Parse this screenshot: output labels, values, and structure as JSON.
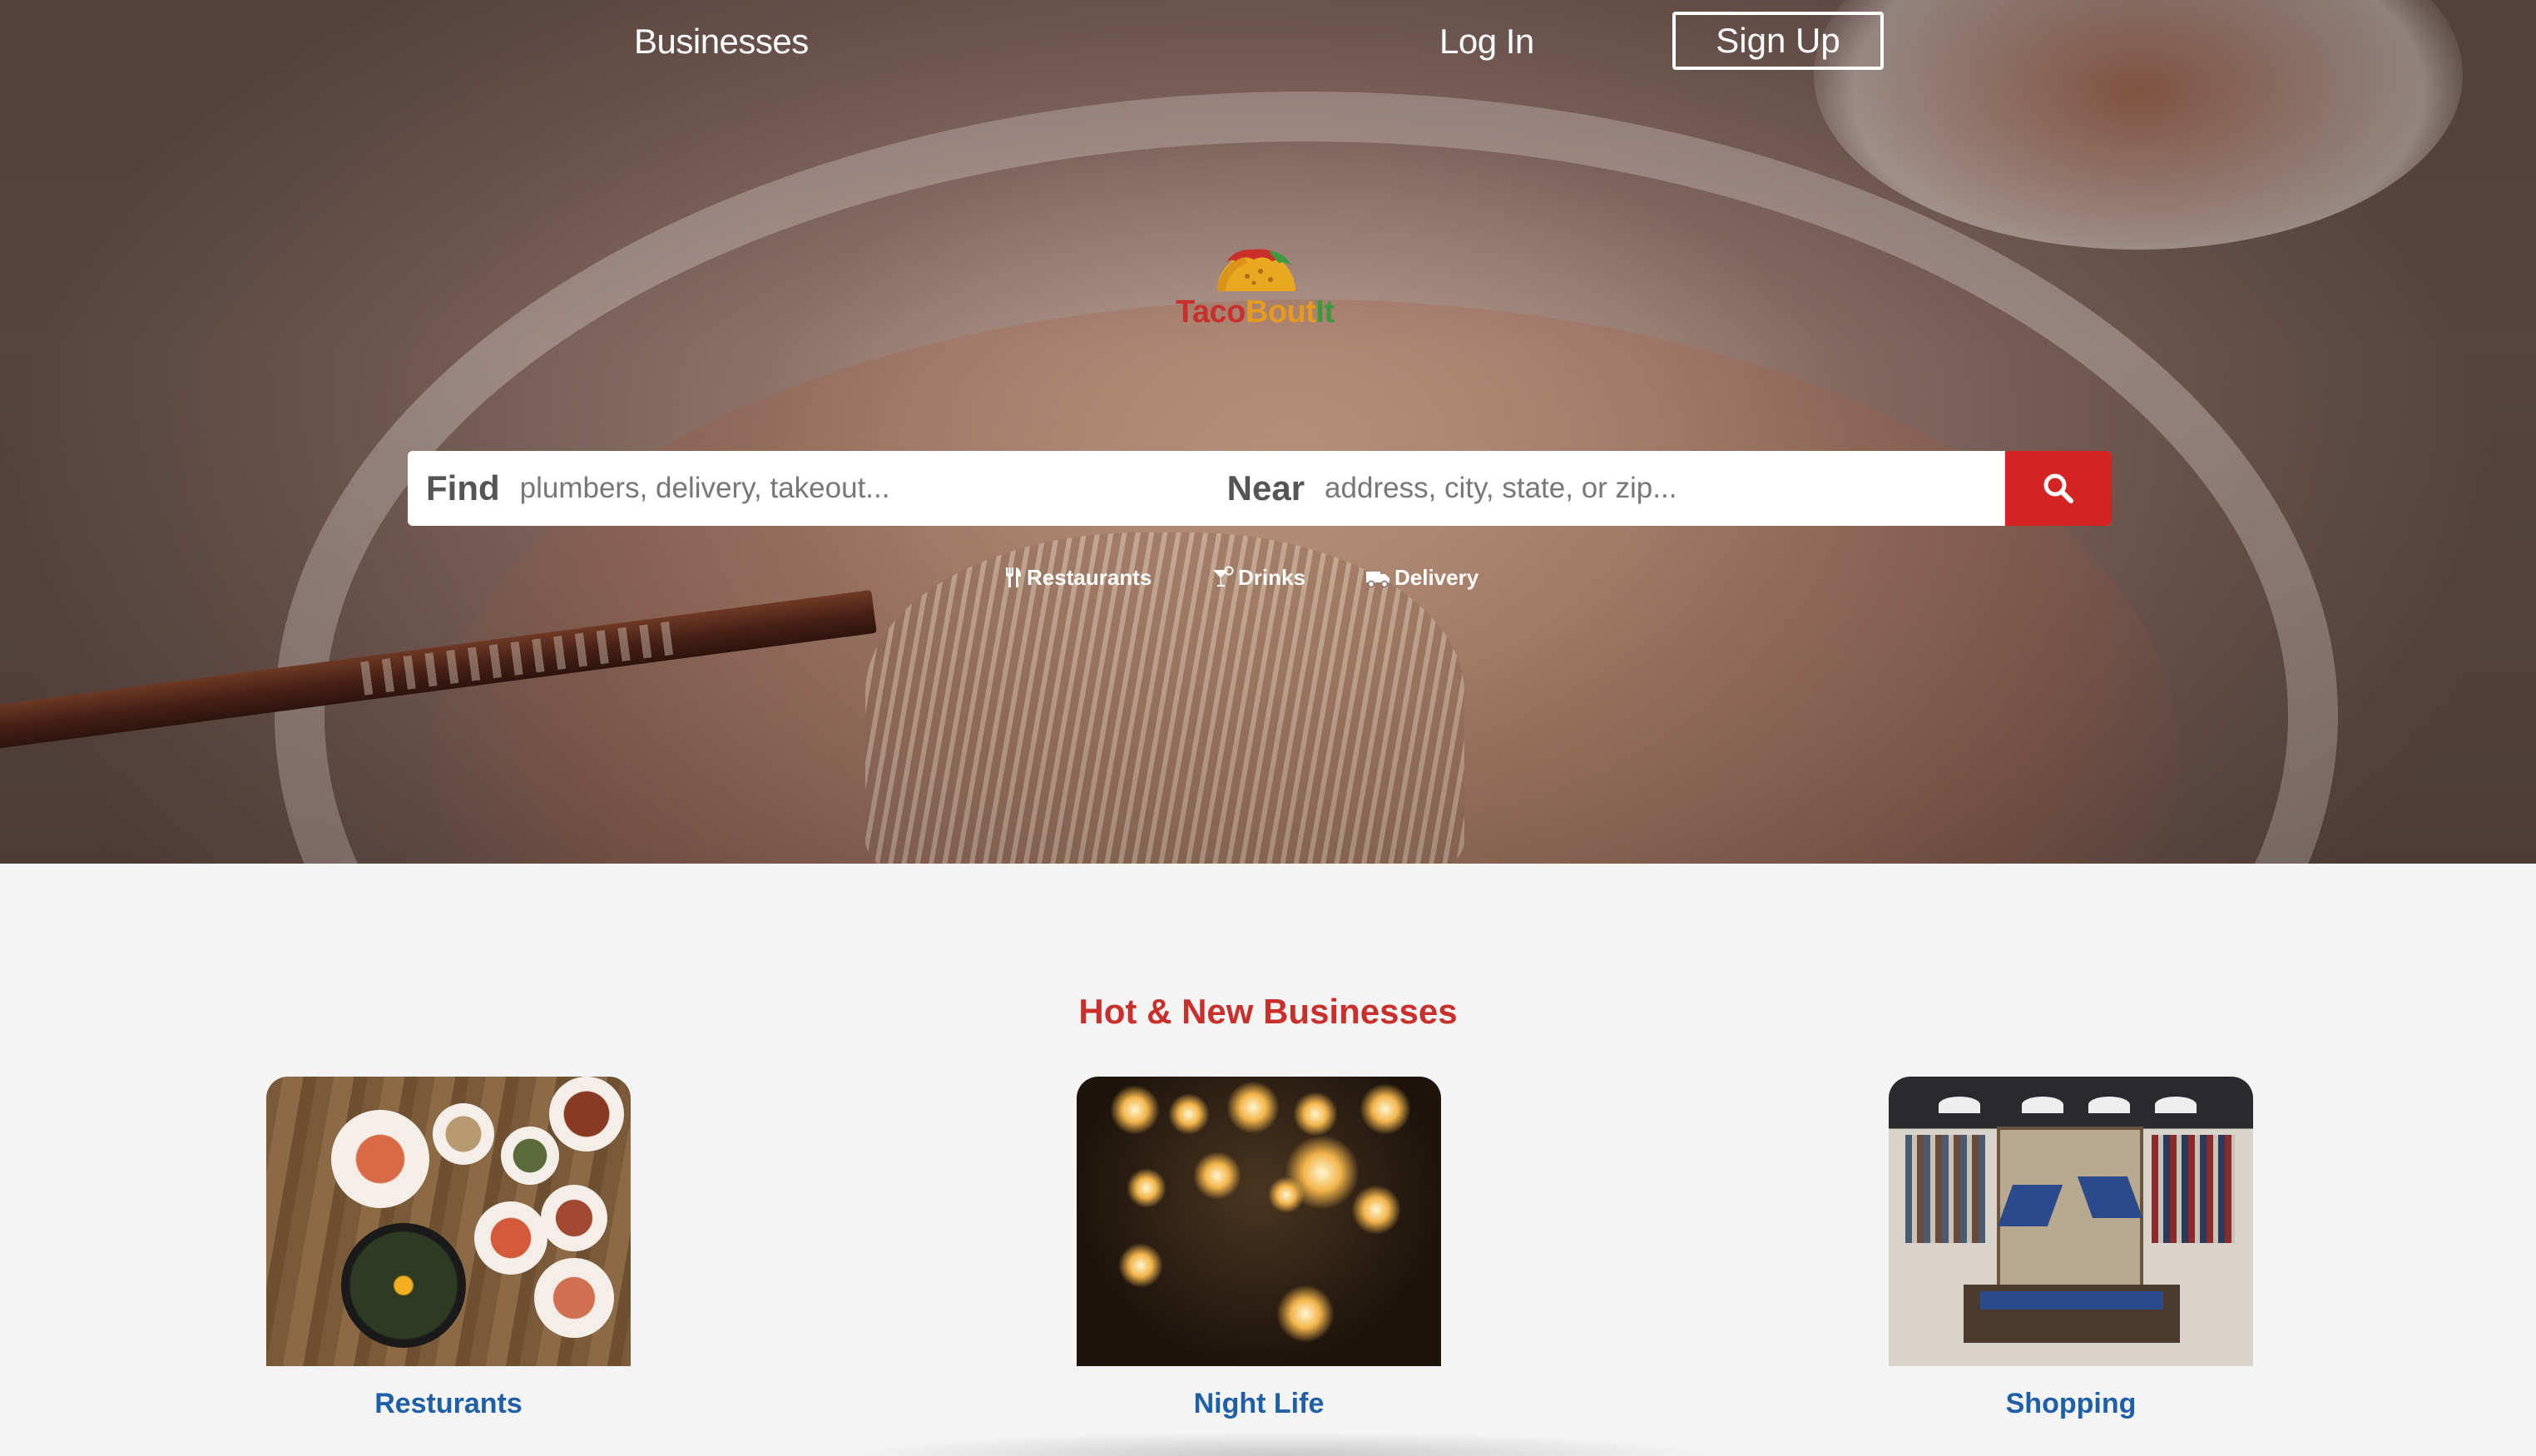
{
  "nav": {
    "businesses": "Businesses",
    "login": "Log In",
    "signup": "Sign Up"
  },
  "logo": {
    "word_part1": "Taco",
    "word_part2": "Bout",
    "word_part3": "It"
  },
  "search": {
    "find_label": "Find",
    "find_placeholder": "plumbers, delivery, takeout...",
    "near_label": "Near",
    "near_placeholder": "address, city, state, or zip...",
    "button_icon": "search-icon"
  },
  "quick_links": [
    {
      "label": "Restaurants",
      "icon": "utensils-icon"
    },
    {
      "label": "Drinks",
      "icon": "cocktail-icon"
    },
    {
      "label": "Delivery",
      "icon": "delivery-truck-icon"
    }
  ],
  "section": {
    "title": "Hot & New Businesses"
  },
  "cards": [
    {
      "label": "Resturants"
    },
    {
      "label": "Night Life"
    },
    {
      "label": "Shopping"
    }
  ],
  "colors": {
    "brand_red": "#d32323",
    "title_red": "#c9302c",
    "link_blue": "#1f5fa8",
    "page_bg": "#f4f4f4"
  }
}
